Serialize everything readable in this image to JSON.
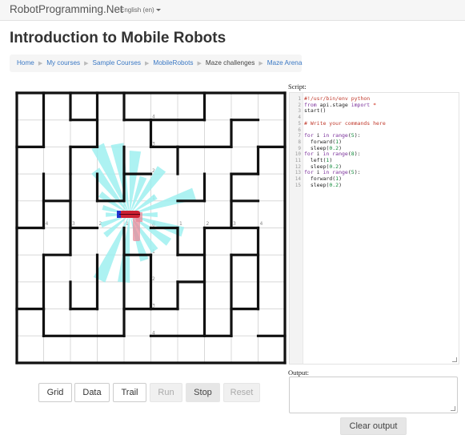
{
  "navbar": {
    "brand": "RobotProgramming.Net",
    "language": "English (en)"
  },
  "page_title": "Introduction to Mobile Robots",
  "breadcrumb": [
    {
      "label": "Home",
      "link": true
    },
    {
      "label": "My courses",
      "link": true
    },
    {
      "label": "Sample Courses",
      "link": true
    },
    {
      "label": "MobileRobots",
      "link": true
    },
    {
      "label": "Maze challenges",
      "link": false
    },
    {
      "label": "Maze Arena",
      "link": true
    }
  ],
  "arena": {
    "grid_cols": 10,
    "grid_rows": 10,
    "row_labels": [
      "4",
      "3",
      "2",
      "1",
      "0",
      "1",
      "2",
      "3",
      "4"
    ],
    "col_labels": [
      "4",
      "3",
      "2",
      "1",
      "0",
      "1",
      "2",
      "3",
      "4"
    ],
    "colors": {
      "wall": "#111111",
      "grid": "#d8d8d8",
      "sensor": "#9ff0f0",
      "trail": "#e88a9a",
      "robot": "#cc2233",
      "robot_nose": "#2233cc"
    }
  },
  "toolbar": {
    "grid": "Grid",
    "data": "Data",
    "trail": "Trail",
    "run": "Run",
    "stop": "Stop",
    "reset": "Reset"
  },
  "script": {
    "label": "Script:",
    "lines": [
      "#!/usr/bin/env python",
      "from api.stage import *",
      "start()",
      "",
      "# Write your commands here",
      "",
      "for i in range(5):",
      "  forward(1)",
      "  sleep(0.2)",
      "for i in range(8):",
      "  left(1)",
      "  sleep(0.2)",
      "for i in range(5):",
      "  forward(1)",
      "  sleep(0.2)"
    ]
  },
  "output": {
    "label": "Output:",
    "clear": "Clear output"
  }
}
